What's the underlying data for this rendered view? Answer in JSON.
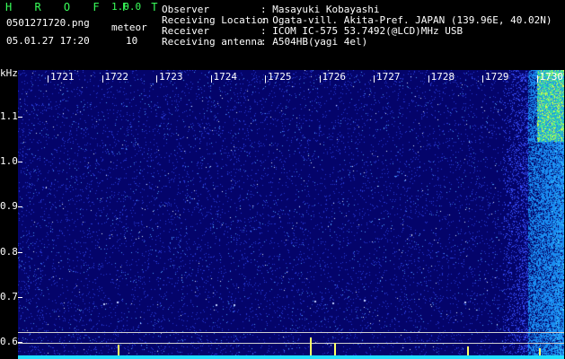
{
  "header": {
    "title": "H R O F F T",
    "version": "1.0.0",
    "filename": "0501271720.png",
    "meteor_label": "meteor",
    "datetime": "05.01.27 17:20",
    "meteor_count": "10"
  },
  "info": [
    {
      "key": "Observer",
      "value": ": Masayuki Kobayashi"
    },
    {
      "key": "Receiving Location",
      "value": ": Ogata-vill. Akita-Pref. JAPAN (139.96E, 40.02N)"
    },
    {
      "key": "Receiver",
      "value": ": ICOM IC-575 53.7492(@LCD)MHz USB"
    },
    {
      "key": "Receiving antenna",
      "value": ": A504HB(yagi 4el)"
    }
  ],
  "axes": {
    "y_unit": "kHz",
    "y_ticks": [
      "1.1",
      "1.0",
      "0.9",
      "0.8",
      "0.7",
      "0.6"
    ],
    "x_ticks": [
      "1721",
      "1722",
      "1723",
      "1724",
      "1725",
      "1726",
      "1727",
      "1728",
      "1729",
      "1730"
    ]
  },
  "colors": {
    "background": "#000000",
    "spectrogram_bg": "#04046a",
    "header_green": "#39ff5a",
    "signal_cyan": "#1fe0ff",
    "signal_yellow": "#ffff66"
  }
}
